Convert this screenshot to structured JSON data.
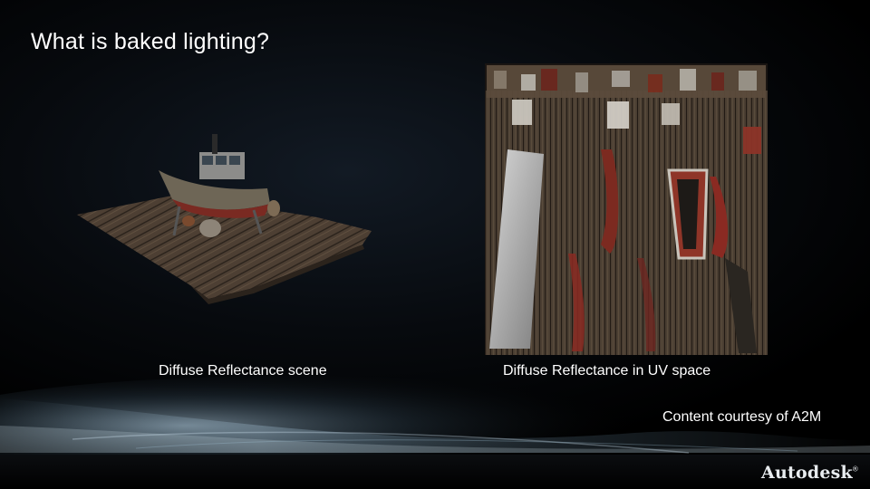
{
  "slide": {
    "title": "What is baked lighting?",
    "left_caption": "Diffuse Reflectance scene",
    "right_caption": "Diffuse Reflectance in UV space",
    "credit": "Content courtesy of A2M"
  },
  "branding": {
    "logo": "Autodesk",
    "logo_mark": "®"
  },
  "colors": {
    "background": "#000000",
    "text": "#ffffff",
    "accent_glow": "#9fc6e0",
    "wood": "#5a4a3a",
    "rust": "#8a2a20"
  },
  "icons": {
    "scene_image": "boat-on-pier-render",
    "uv_image": "uv-texture-atlas"
  }
}
